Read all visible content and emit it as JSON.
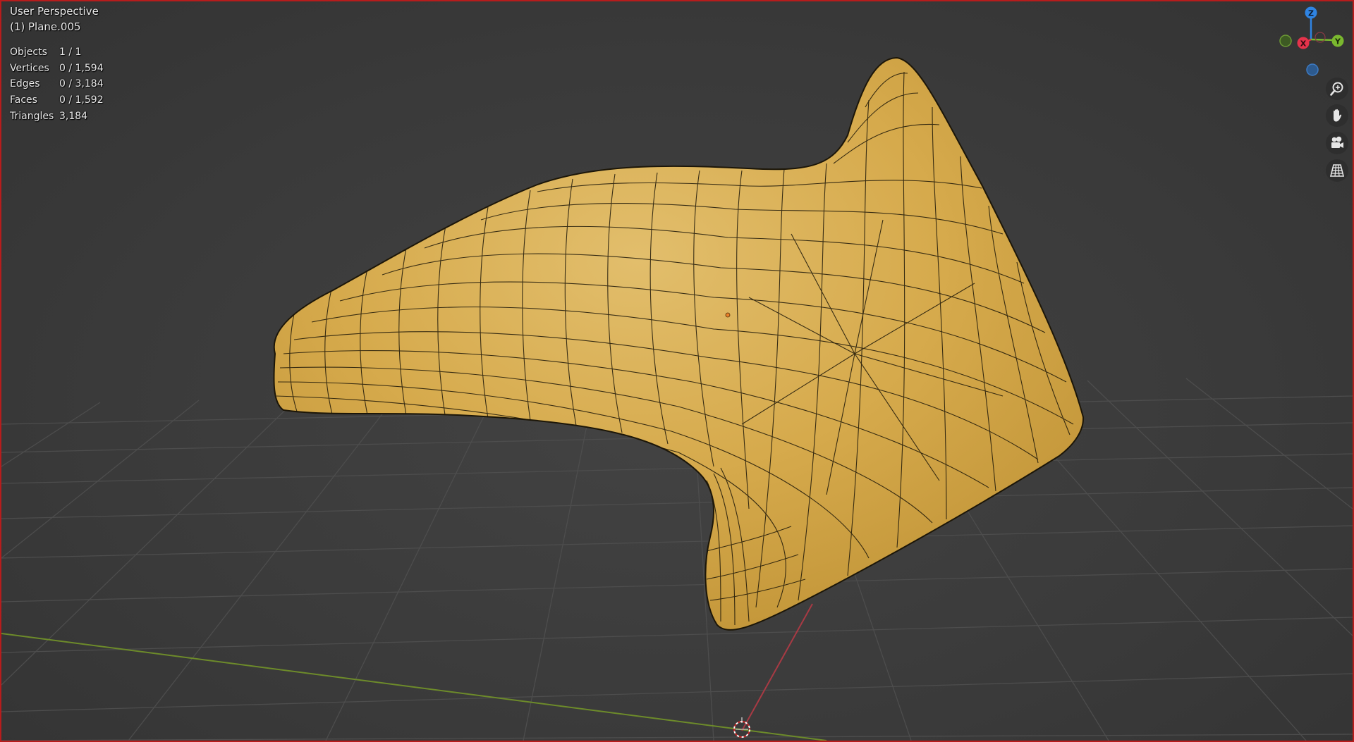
{
  "viewport": {
    "view_name": "User Perspective",
    "object_name": "(1) Plane.005"
  },
  "stats": [
    {
      "label": "Objects",
      "value": "1 / 1"
    },
    {
      "label": "Vertices",
      "value": "0 / 1,594"
    },
    {
      "label": "Edges",
      "value": "0 / 3,184"
    },
    {
      "label": "Faces",
      "value": "0 / 1,592"
    },
    {
      "label": "Triangles",
      "value": "3,184"
    }
  ],
  "gizmo": {
    "z_label": "Z",
    "x_label": "X",
    "y_label": "Y",
    "colors": {
      "x": "#e5334b",
      "y": "#7ab82f",
      "z": "#2f84e3"
    }
  },
  "tools": [
    {
      "name": "zoom-icon"
    },
    {
      "name": "hand-pan-icon"
    },
    {
      "name": "camera-icon"
    },
    {
      "name": "grid-ortho-icon"
    }
  ],
  "colors": {
    "background": "#3d3d3d",
    "grid_line": "#4b4b4b",
    "x_axis": "#a83a44",
    "y_axis": "#6d8b2a",
    "mesh_fill": "#d4a84a",
    "wire": "#1c1608",
    "selection_border": "#b71c1c"
  }
}
